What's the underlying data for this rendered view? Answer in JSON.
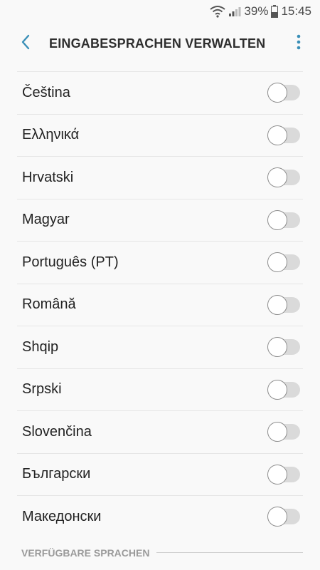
{
  "status_bar": {
    "battery": "39%",
    "time": "15:45",
    "icons": [
      "wifi-icon",
      "signal-icon",
      "battery-icon"
    ]
  },
  "header": {
    "title": "EINGABESPRACHEN VERWALTEN",
    "back_icon": "chevron-left-icon",
    "more_icon": "more-vertical-icon"
  },
  "languages": [
    {
      "label": "Čeština",
      "enabled": false
    },
    {
      "label": "Ελληνικά",
      "enabled": false
    },
    {
      "label": "Hrvatski",
      "enabled": false
    },
    {
      "label": "Magyar",
      "enabled": false
    },
    {
      "label": "Português (PT)",
      "enabled": false
    },
    {
      "label": "Română",
      "enabled": false
    },
    {
      "label": "Shqip",
      "enabled": false
    },
    {
      "label": "Srpski",
      "enabled": false
    },
    {
      "label": "Slovenčina",
      "enabled": false
    },
    {
      "label": "Български",
      "enabled": false
    },
    {
      "label": "Македонски",
      "enabled": false
    }
  ],
  "section": {
    "available_label": "VERFÜGBARE SPRACHEN"
  },
  "colors": {
    "accent": "#3a8fb7",
    "background": "#f9f9f9",
    "toggle_off_track": "#dadada"
  }
}
